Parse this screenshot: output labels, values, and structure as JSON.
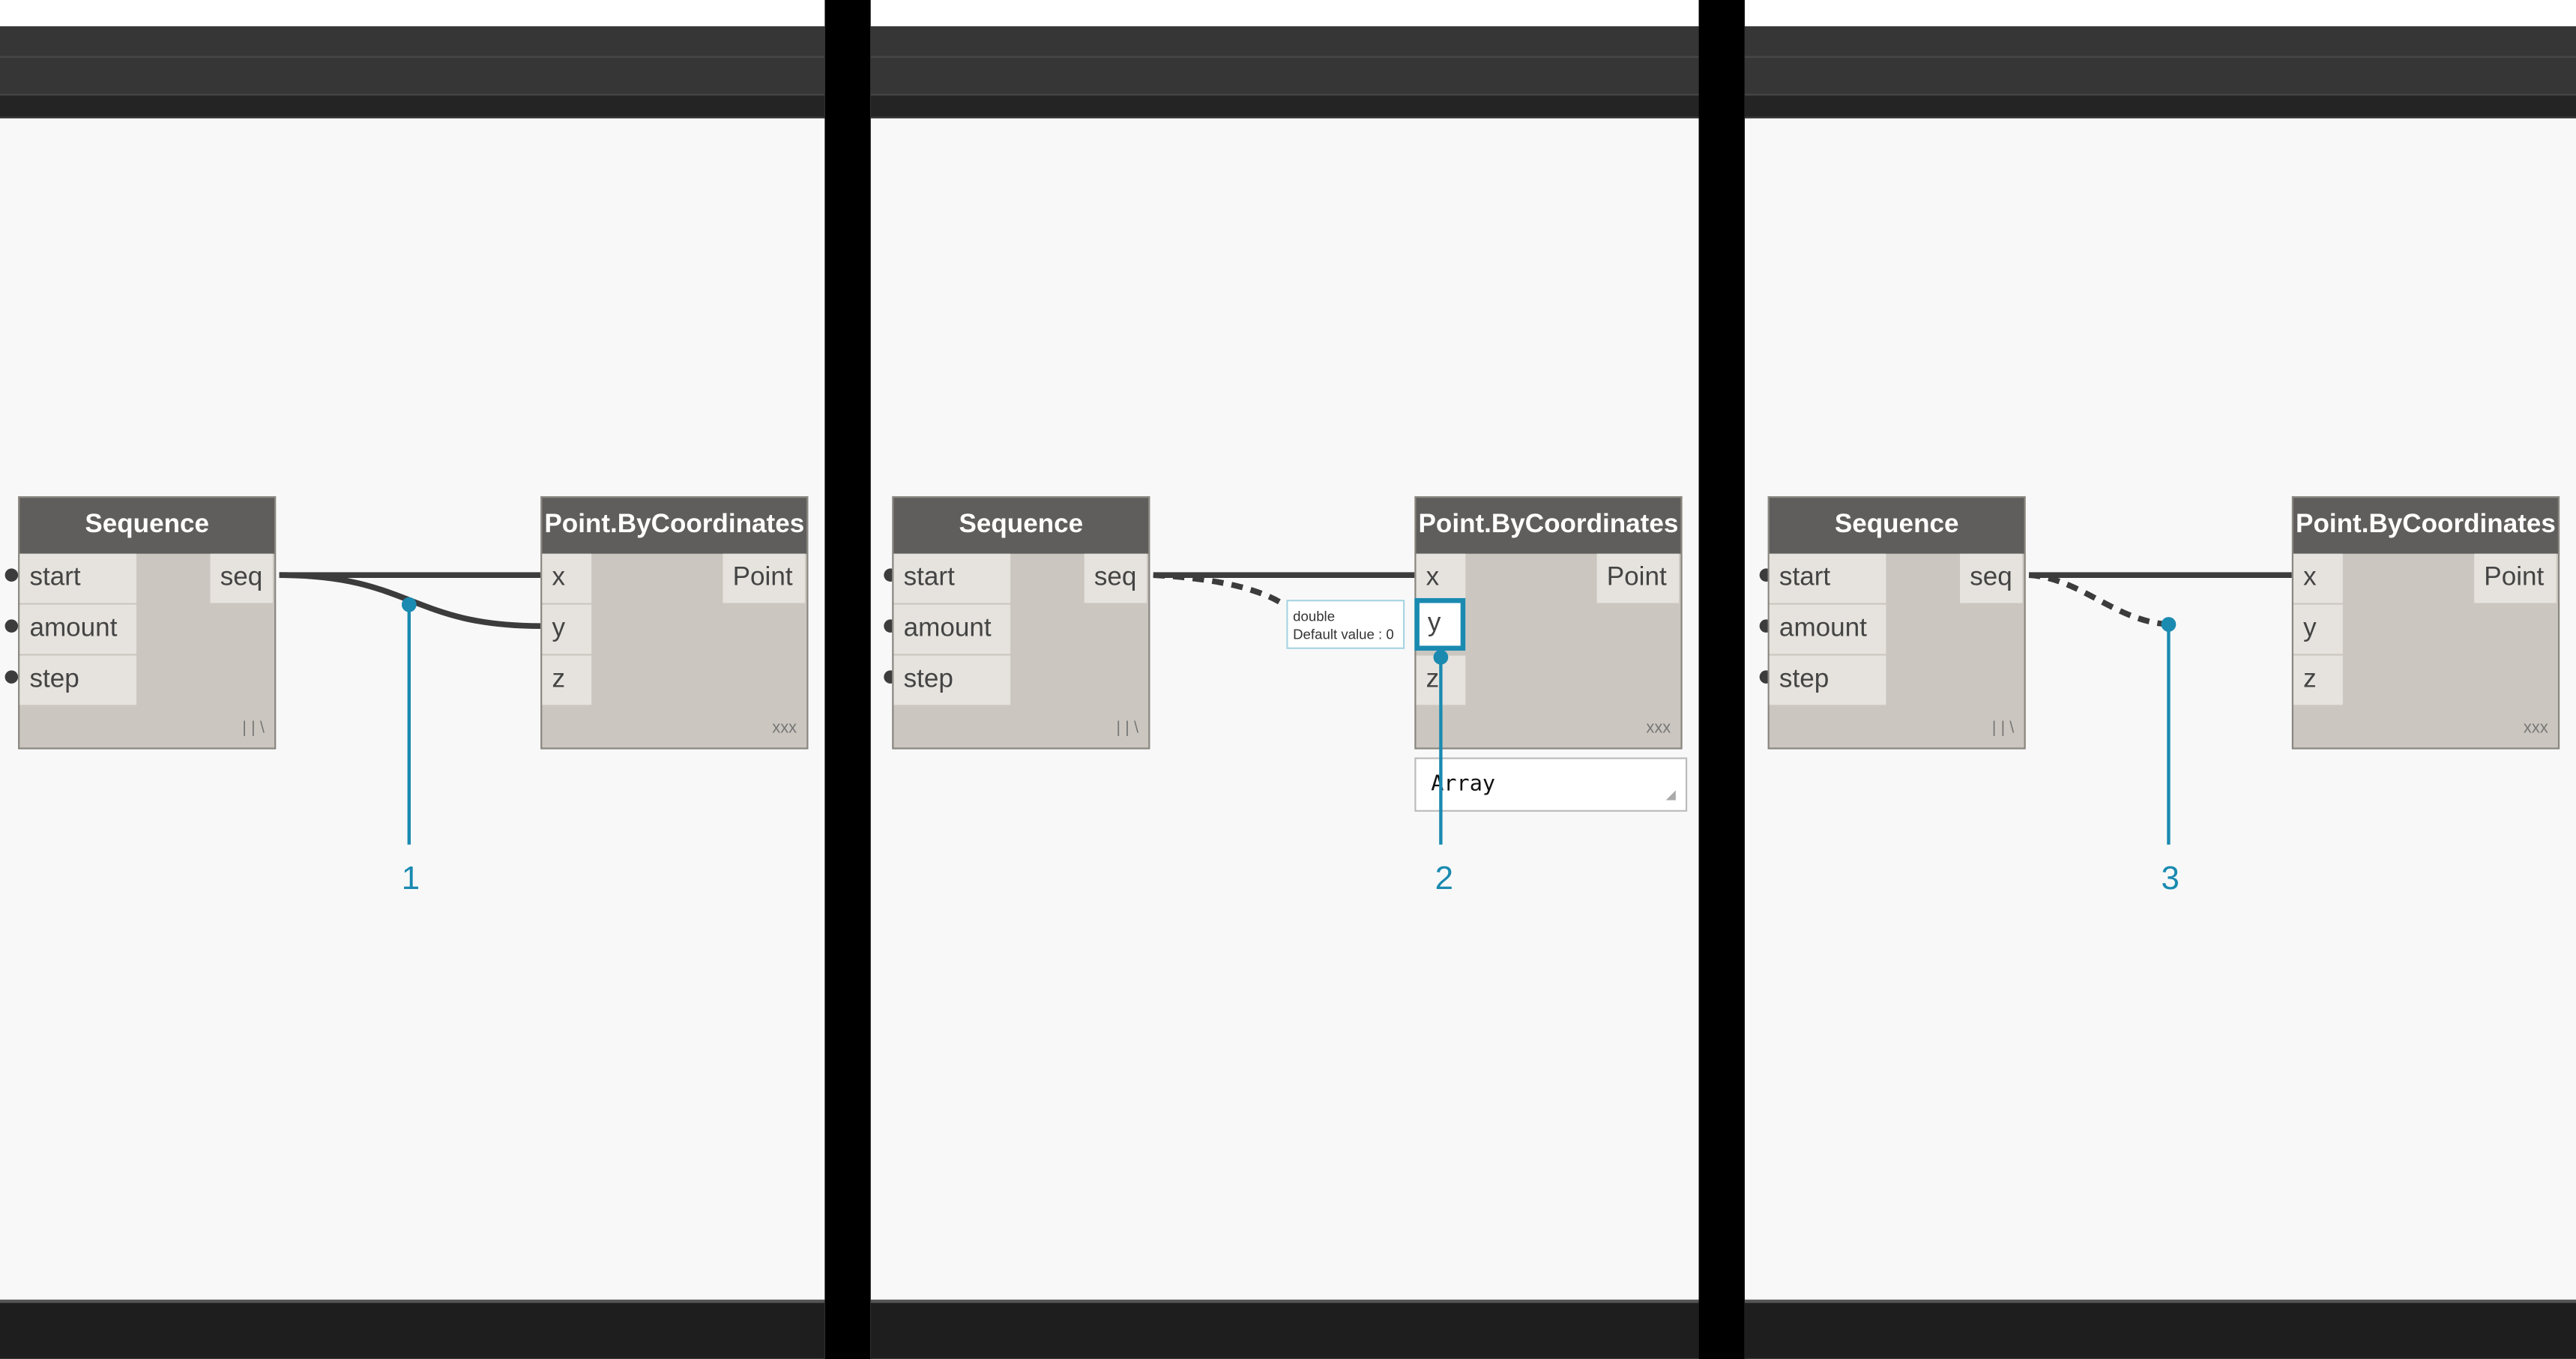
{
  "colors": {
    "callout": "#1a8ab0",
    "node_header": "#5f5e5c",
    "node_body": "#cbc7c0",
    "canvas": "#f8f8f8",
    "wire": "#3c3c3c"
  },
  "panels": [
    {
      "callout": "1",
      "sequence": {
        "title": "Sequence",
        "inputs": [
          "start",
          "amount",
          "step"
        ],
        "output": "seq",
        "lacing": "| | \\"
      },
      "point": {
        "title": "Point.ByCoordinates",
        "inputs": [
          "x",
          "y",
          "z"
        ],
        "output": "Point",
        "lacing": "xxx"
      }
    },
    {
      "callout": "2",
      "sequence": {
        "title": "Sequence",
        "inputs": [
          "start",
          "amount",
          "step"
        ],
        "output": "seq",
        "lacing": "| | \\"
      },
      "point": {
        "title": "Point.ByCoordinates",
        "inputs": [
          "x",
          "y",
          "z"
        ],
        "output": "Point",
        "lacing": "xxx"
      },
      "tooltip": {
        "type": "double",
        "default": "Default value : 0"
      },
      "preview": "Array"
    },
    {
      "callout": "3",
      "sequence": {
        "title": "Sequence",
        "inputs": [
          "start",
          "amount",
          "step"
        ],
        "output": "seq",
        "lacing": "| | \\"
      },
      "point": {
        "title": "Point.ByCoordinates",
        "inputs": [
          "x",
          "y",
          "z"
        ],
        "output": "Point",
        "lacing": "xxx"
      }
    }
  ]
}
